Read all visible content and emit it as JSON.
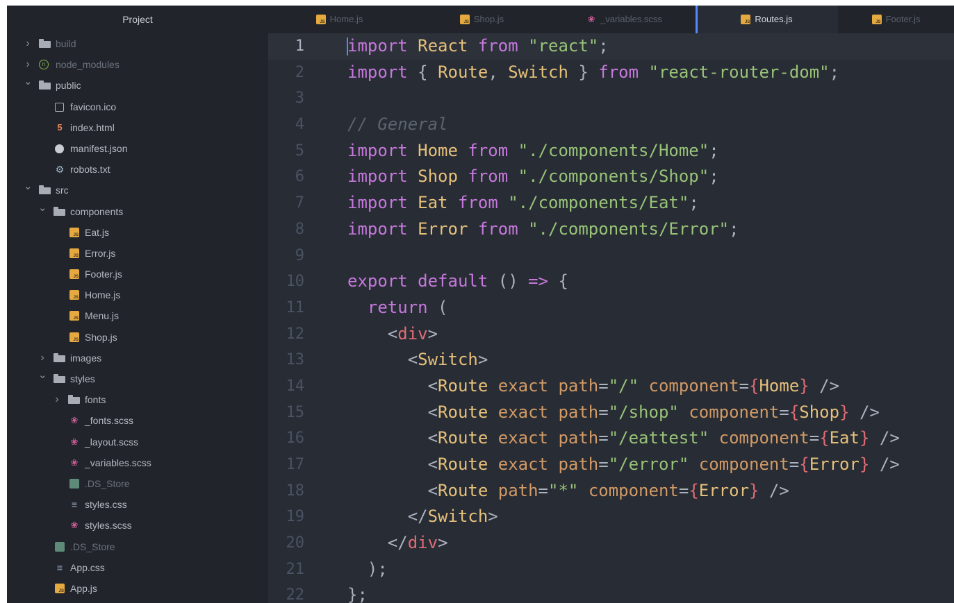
{
  "sidebar": {
    "title": "Project",
    "tree": [
      {
        "depth": 0,
        "type": "folder",
        "expanded": false,
        "name": "build",
        "icon": "folder-icon",
        "dim": true
      },
      {
        "depth": 0,
        "type": "folder",
        "expanded": false,
        "name": "node_modules",
        "icon": "node-modules-icon",
        "dim": true
      },
      {
        "depth": 0,
        "type": "folder",
        "expanded": true,
        "name": "public",
        "icon": "folder-icon"
      },
      {
        "depth": 1,
        "type": "file",
        "name": "favicon.ico",
        "icon": "image-file-icon"
      },
      {
        "depth": 1,
        "type": "file",
        "name": "index.html",
        "icon": "html-file-icon"
      },
      {
        "depth": 1,
        "type": "file",
        "name": "manifest.json",
        "icon": "json-file-icon"
      },
      {
        "depth": 1,
        "type": "file",
        "name": "robots.txt",
        "icon": "robot-file-icon"
      },
      {
        "depth": 0,
        "type": "folder",
        "expanded": true,
        "name": "src",
        "icon": "folder-icon"
      },
      {
        "depth": 1,
        "type": "folder",
        "expanded": true,
        "name": "components",
        "icon": "folder-icon"
      },
      {
        "depth": 2,
        "type": "file",
        "name": "Eat.js",
        "icon": "js-file-icon"
      },
      {
        "depth": 2,
        "type": "file",
        "name": "Error.js",
        "icon": "js-file-icon"
      },
      {
        "depth": 2,
        "type": "file",
        "name": "Footer.js",
        "icon": "js-file-icon"
      },
      {
        "depth": 2,
        "type": "file",
        "name": "Home.js",
        "icon": "js-file-icon"
      },
      {
        "depth": 2,
        "type": "file",
        "name": "Menu.js",
        "icon": "js-file-icon"
      },
      {
        "depth": 2,
        "type": "file",
        "name": "Shop.js",
        "icon": "js-file-icon"
      },
      {
        "depth": 1,
        "type": "folder",
        "expanded": false,
        "name": "images",
        "icon": "folder-icon"
      },
      {
        "depth": 1,
        "type": "folder",
        "expanded": true,
        "name": "styles",
        "icon": "folder-icon"
      },
      {
        "depth": 2,
        "type": "folder",
        "expanded": false,
        "name": "fonts",
        "icon": "folder-icon"
      },
      {
        "depth": 2,
        "type": "file",
        "name": "_fonts.scss",
        "icon": "sass-file-icon"
      },
      {
        "depth": 2,
        "type": "file",
        "name": "_layout.scss",
        "icon": "sass-file-icon"
      },
      {
        "depth": 2,
        "type": "file",
        "name": "_variables.scss",
        "icon": "sass-file-icon"
      },
      {
        "depth": 2,
        "type": "file",
        "name": ".DS_Store",
        "icon": "ds-store-icon",
        "dim": true
      },
      {
        "depth": 2,
        "type": "file",
        "name": "styles.css",
        "icon": "css-file-icon"
      },
      {
        "depth": 2,
        "type": "file",
        "name": "styles.scss",
        "icon": "sass-file-icon"
      },
      {
        "depth": 1,
        "type": "file",
        "name": ".DS_Store",
        "icon": "ds-store-icon",
        "dim": true
      },
      {
        "depth": 1,
        "type": "file",
        "name": "App.css",
        "icon": "css-file-icon"
      },
      {
        "depth": 1,
        "type": "file",
        "name": "App.js",
        "icon": "js-file-icon"
      }
    ]
  },
  "tabs": [
    {
      "label": "Home.js",
      "icon": "js-file-icon",
      "active": false
    },
    {
      "label": "Shop.js",
      "icon": "js-file-icon",
      "active": false
    },
    {
      "label": "_variables.scss",
      "icon": "sass-file-icon",
      "active": false
    },
    {
      "label": "Routes.js",
      "icon": "js-file-icon",
      "active": true
    },
    {
      "label": "Footer.js",
      "icon": "js-file-icon",
      "active": false
    }
  ],
  "editor": {
    "current_line": 1,
    "lines": [
      {
        "n": "1",
        "t": [
          [
            "kw",
            "import"
          ],
          [
            "pun",
            " "
          ],
          [
            "txt",
            "React"
          ],
          [
            "pun",
            " "
          ],
          [
            "kw",
            "from"
          ],
          [
            "pun",
            " "
          ],
          [
            "str",
            "\"react\""
          ],
          [
            "pun",
            ";"
          ]
        ]
      },
      {
        "n": "2",
        "t": [
          [
            "kw",
            "import"
          ],
          [
            "pun",
            " { "
          ],
          [
            "txt",
            "Route"
          ],
          [
            "pun",
            ", "
          ],
          [
            "txt",
            "Switch"
          ],
          [
            "pun",
            " } "
          ],
          [
            "kw",
            "from"
          ],
          [
            "pun",
            " "
          ],
          [
            "str",
            "\"react-router-dom\""
          ],
          [
            "pun",
            ";"
          ]
        ]
      },
      {
        "n": "3",
        "t": []
      },
      {
        "n": "4",
        "t": [
          [
            "cmt",
            "// General"
          ]
        ]
      },
      {
        "n": "5",
        "t": [
          [
            "kw",
            "import"
          ],
          [
            "pun",
            " "
          ],
          [
            "txt",
            "Home"
          ],
          [
            "pun",
            " "
          ],
          [
            "kw",
            "from"
          ],
          [
            "pun",
            " "
          ],
          [
            "str",
            "\"./components/Home\""
          ],
          [
            "pun",
            ";"
          ]
        ]
      },
      {
        "n": "6",
        "t": [
          [
            "kw",
            "import"
          ],
          [
            "pun",
            " "
          ],
          [
            "txt",
            "Shop"
          ],
          [
            "pun",
            " "
          ],
          [
            "kw",
            "from"
          ],
          [
            "pun",
            " "
          ],
          [
            "str",
            "\"./components/Shop\""
          ],
          [
            "pun",
            ";"
          ]
        ]
      },
      {
        "n": "7",
        "t": [
          [
            "kw",
            "import"
          ],
          [
            "pun",
            " "
          ],
          [
            "txt",
            "Eat"
          ],
          [
            "pun",
            " "
          ],
          [
            "kw",
            "from"
          ],
          [
            "pun",
            " "
          ],
          [
            "str",
            "\"./components/Eat\""
          ],
          [
            "pun",
            ";"
          ]
        ]
      },
      {
        "n": "8",
        "t": [
          [
            "kw",
            "import"
          ],
          [
            "pun",
            " "
          ],
          [
            "txt",
            "Error"
          ],
          [
            "pun",
            " "
          ],
          [
            "kw",
            "from"
          ],
          [
            "pun",
            " "
          ],
          [
            "str",
            "\"./components/Error\""
          ],
          [
            "pun",
            ";"
          ]
        ]
      },
      {
        "n": "9",
        "t": []
      },
      {
        "n": "10",
        "t": [
          [
            "kw",
            "export"
          ],
          [
            "pun",
            " "
          ],
          [
            "kw",
            "default"
          ],
          [
            "pun",
            " () "
          ],
          [
            "kw",
            "=>"
          ],
          [
            "pun",
            " {"
          ]
        ]
      },
      {
        "n": "11",
        "t": [
          [
            "pun",
            "  "
          ],
          [
            "kw",
            "return"
          ],
          [
            "pun",
            " ("
          ]
        ]
      },
      {
        "n": "12",
        "t": [
          [
            "pun",
            "    <"
          ],
          [
            "tag",
            "div"
          ],
          [
            "pun",
            ">"
          ]
        ]
      },
      {
        "n": "13",
        "t": [
          [
            "pun",
            "      <"
          ],
          [
            "tagn",
            "Switch"
          ],
          [
            "pun",
            ">"
          ]
        ]
      },
      {
        "n": "14",
        "t": [
          [
            "pun",
            "        <"
          ],
          [
            "tagn",
            "Route"
          ],
          [
            "pun",
            " "
          ],
          [
            "attr",
            "exact"
          ],
          [
            "pun",
            " "
          ],
          [
            "attr",
            "path"
          ],
          [
            "pun",
            "="
          ],
          [
            "str",
            "\"/\""
          ],
          [
            "pun",
            " "
          ],
          [
            "attr",
            "component"
          ],
          [
            "pun",
            "="
          ],
          [
            "brc",
            "{"
          ],
          [
            "txt",
            "Home"
          ],
          [
            "brc",
            "}"
          ],
          [
            "pun",
            " />"
          ]
        ]
      },
      {
        "n": "15",
        "t": [
          [
            "pun",
            "        <"
          ],
          [
            "tagn",
            "Route"
          ],
          [
            "pun",
            " "
          ],
          [
            "attr",
            "exact"
          ],
          [
            "pun",
            " "
          ],
          [
            "attr",
            "path"
          ],
          [
            "pun",
            "="
          ],
          [
            "str",
            "\"/shop\""
          ],
          [
            "pun",
            " "
          ],
          [
            "attr",
            "component"
          ],
          [
            "pun",
            "="
          ],
          [
            "brc",
            "{"
          ],
          [
            "txt",
            "Shop"
          ],
          [
            "brc",
            "}"
          ],
          [
            "pun",
            " />"
          ]
        ]
      },
      {
        "n": "16",
        "t": [
          [
            "pun",
            "        <"
          ],
          [
            "tagn",
            "Route"
          ],
          [
            "pun",
            " "
          ],
          [
            "attr",
            "exact"
          ],
          [
            "pun",
            " "
          ],
          [
            "attr",
            "path"
          ],
          [
            "pun",
            "="
          ],
          [
            "str",
            "\"/eattest\""
          ],
          [
            "pun",
            " "
          ],
          [
            "attr",
            "component"
          ],
          [
            "pun",
            "="
          ],
          [
            "brc",
            "{"
          ],
          [
            "txt",
            "Eat"
          ],
          [
            "brc",
            "}"
          ],
          [
            "pun",
            " />"
          ]
        ]
      },
      {
        "n": "17",
        "t": [
          [
            "pun",
            "        <"
          ],
          [
            "tagn",
            "Route"
          ],
          [
            "pun",
            " "
          ],
          [
            "attr",
            "exact"
          ],
          [
            "pun",
            " "
          ],
          [
            "attr",
            "path"
          ],
          [
            "pun",
            "="
          ],
          [
            "str",
            "\"/error\""
          ],
          [
            "pun",
            " "
          ],
          [
            "attr",
            "component"
          ],
          [
            "pun",
            "="
          ],
          [
            "brc",
            "{"
          ],
          [
            "txt",
            "Error"
          ],
          [
            "brc",
            "}"
          ],
          [
            "pun",
            " />"
          ]
        ]
      },
      {
        "n": "18",
        "t": [
          [
            "pun",
            "        <"
          ],
          [
            "tagn",
            "Route"
          ],
          [
            "pun",
            " "
          ],
          [
            "attr",
            "path"
          ],
          [
            "pun",
            "="
          ],
          [
            "str",
            "\"*\""
          ],
          [
            "pun",
            " "
          ],
          [
            "attr",
            "component"
          ],
          [
            "pun",
            "="
          ],
          [
            "brc",
            "{"
          ],
          [
            "txt",
            "Error"
          ],
          [
            "brc",
            "}"
          ],
          [
            "pun",
            " />"
          ]
        ]
      },
      {
        "n": "19",
        "t": [
          [
            "pun",
            "      </"
          ],
          [
            "tagn",
            "Switch"
          ],
          [
            "pun",
            ">"
          ]
        ]
      },
      {
        "n": "20",
        "t": [
          [
            "pun",
            "    </"
          ],
          [
            "tag",
            "div"
          ],
          [
            "pun",
            ">"
          ]
        ]
      },
      {
        "n": "21",
        "t": [
          [
            "pun",
            "  );"
          ]
        ]
      },
      {
        "n": "22",
        "t": [
          [
            "pun",
            "};"
          ]
        ]
      }
    ]
  },
  "colors": {
    "keyword": "#c678dd",
    "string": "#98c379",
    "comment": "#5c6370",
    "tag": "#e06c75",
    "attribute": "#d19a66",
    "accent": "#528bff"
  }
}
